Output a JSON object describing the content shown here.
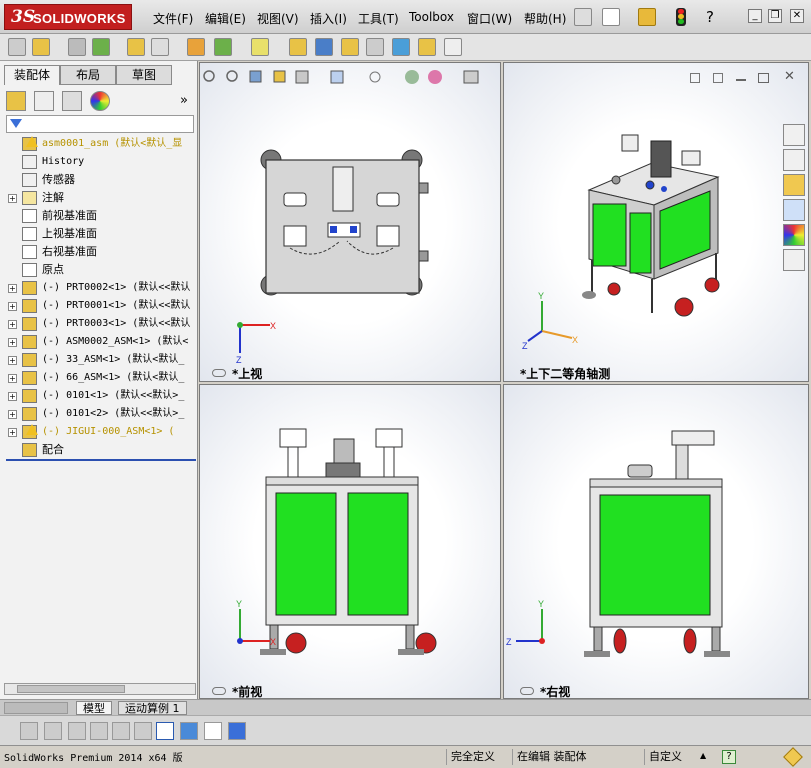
{
  "app": {
    "logo_ds": "3S",
    "logo_text": "SOLIDWORKS"
  },
  "menu": [
    "文件(F)",
    "编辑(E)",
    "视图(V)",
    "插入(I)",
    "工具(T)",
    "Toolbox",
    "窗口(W)",
    "帮助(H)"
  ],
  "titlebar_help": "?",
  "panel_tabs": [
    "装配体",
    "布局",
    "草图"
  ],
  "panel_more": "»",
  "tree": [
    {
      "label": "asm0001_asm  (默认<默认_显",
      "warn": true,
      "exp": ""
    },
    {
      "label": "History",
      "exp": ""
    },
    {
      "label": "传感器",
      "exp": ""
    },
    {
      "label": "注解",
      "exp": "+"
    },
    {
      "label": "前视基准面",
      "exp": ""
    },
    {
      "label": "上视基准面",
      "exp": ""
    },
    {
      "label": "右视基准面",
      "exp": ""
    },
    {
      "label": "原点",
      "exp": ""
    },
    {
      "label": "(-) PRT0002<1> (默认<<默认",
      "exp": "+"
    },
    {
      "label": "(-) PRT0001<1> (默认<<默认",
      "exp": "+"
    },
    {
      "label": "(-) PRT0003<1> (默认<<默认",
      "exp": "+"
    },
    {
      "label": "(-) ASM0002_ASM<1> (默认<",
      "exp": "+"
    },
    {
      "label": "(-) 33_ASM<1> (默认<默认_",
      "exp": "+"
    },
    {
      "label": "(-) 66_ASM<1> (默认<默认_",
      "exp": "+"
    },
    {
      "label": "(-) 0101<1> (默认<<默认>_",
      "exp": "+"
    },
    {
      "label": "(-) 0101<2> (默认<<默认>_",
      "exp": "+"
    },
    {
      "label": "(-) JIGUI-000_ASM<1> (",
      "warn": true,
      "exp": "+"
    },
    {
      "label": "配合",
      "exp": ""
    }
  ],
  "bottom_tabs": [
    "模型",
    "运动算例 1"
  ],
  "status": {
    "version": "SolidWorks Premium 2014 x64 版",
    "defined": "完全定义",
    "editing": "在编辑 装配体",
    "custom": "自定义",
    "arrow": "▲"
  },
  "viewports": {
    "top": "*上视",
    "iso": "*上下二等角轴测",
    "front": "*前视",
    "right": "*右视"
  },
  "axes": {
    "x": "X",
    "y": "Y",
    "z": "Z"
  },
  "colors": {
    "door_green": "#21e021",
    "logo_red": "#c21f1f",
    "caster_red": "#c62020"
  }
}
